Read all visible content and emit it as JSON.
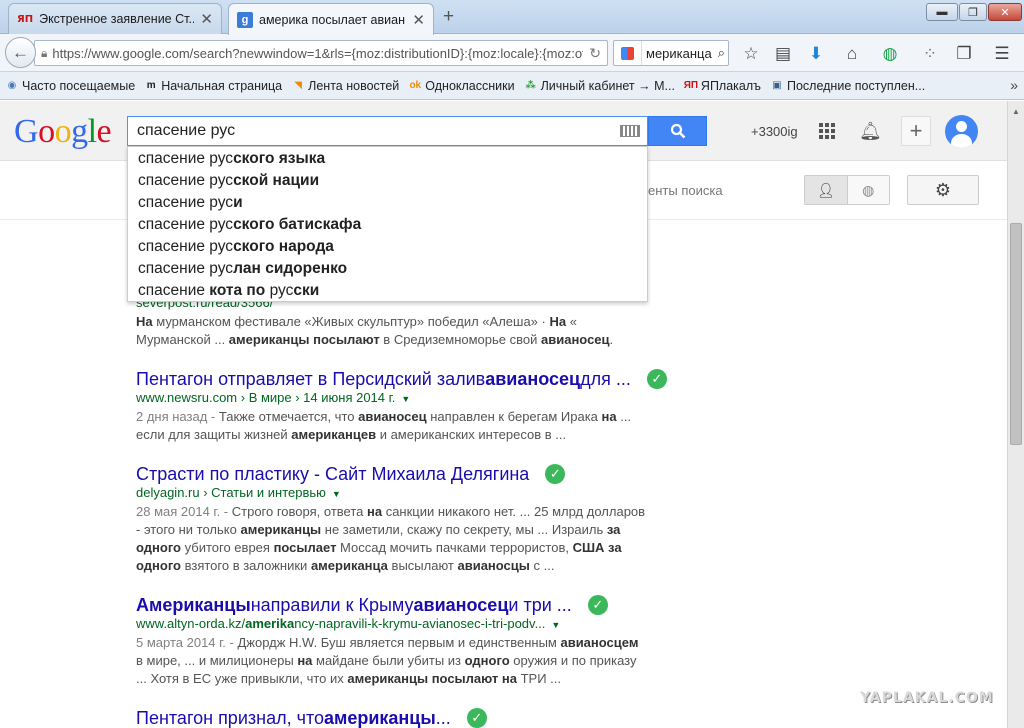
{
  "browser": {
    "tabs": [
      {
        "favicon": "ЯП",
        "title": "Экстренное заявление Ст...",
        "close": "✕"
      },
      {
        "favicon": "g",
        "title": "америка посылает авиан...",
        "close": "✕"
      }
    ],
    "new_tab": "+",
    "window_controls": {
      "minimize": "▬",
      "maximize": "❐",
      "close": "✕"
    },
    "url": "https://www.google.com/search?newwindow=1&rls={moz:distributionID}:{moz:locale}:{moz:offi",
    "search_value": "мериканца"
  },
  "bookmarks": [
    {
      "icon": "globe-icon",
      "glyph": "◉",
      "color": "#4a7ab5",
      "label": "Часто посещаемые"
    },
    {
      "icon": "m-logo-icon",
      "glyph": "m",
      "color": "#222222",
      "label": "Начальная страница"
    },
    {
      "icon": "rss-icon",
      "glyph": "◥",
      "color": "#f08a00",
      "label": "Лента новостей"
    },
    {
      "icon": "odnoklassniki-icon",
      "glyph": "ok",
      "color": "#f08a00",
      "label": "Одноклассники"
    },
    {
      "icon": "colored-dots-icon",
      "glyph": "⁂",
      "color": "#2e9d3a",
      "label": "Личный кабинет → М..."
    },
    {
      "icon": "yaplakal-icon",
      "glyph": "ЯП",
      "color": "#d01010",
      "label": "ЯПлакалъ"
    },
    {
      "icon": "page-icon",
      "glyph": "▣",
      "color": "#3a5f8a",
      "label": "Последние поступлен..."
    }
  ],
  "google": {
    "query": "спасение рус",
    "user_label": "+3300ig",
    "search_tools_fragment": "енты поиска",
    "suggestions": [
      [
        {
          "t": "спасение рус",
          "b": false
        },
        {
          "t": "ского языка",
          "b": true
        }
      ],
      [
        {
          "t": "спасение рус",
          "b": false
        },
        {
          "t": "ской нации",
          "b": true
        }
      ],
      [
        {
          "t": "спасение рус",
          "b": false
        },
        {
          "t": "и",
          "b": true
        }
      ],
      [
        {
          "t": "спасение рус",
          "b": false
        },
        {
          "t": "ского батискафа",
          "b": true
        }
      ],
      [
        {
          "t": "спасение рус",
          "b": false
        },
        {
          "t": "ского народа",
          "b": true
        }
      ],
      [
        {
          "t": "спасение рус",
          "b": false
        },
        {
          "t": "лан сидоренко",
          "b": true
        }
      ],
      [
        {
          "t": "спасение ",
          "b": false
        },
        {
          "t": "кота по ",
          "b": true
        },
        {
          "t": "рус",
          "b": false
        },
        {
          "t": "ски",
          "b": true
        }
      ]
    ],
    "results": [
      {
        "title": [],
        "url": "severpost.ru/read/3566/",
        "has_dropdown": false,
        "verified": false,
        "snippet": [
          [
            {
              "t": "На",
              "b": true
            },
            {
              "t": " мурманском фестивале «Живых скульптур» победил «Алеша» · ",
              "b": false
            },
            {
              "t": "На",
              "b": true
            },
            {
              "t": " «",
              "b": false
            }
          ],
          [
            {
              "t": "Мурманской ... ",
              "b": false
            },
            {
              "t": "американцы посылают",
              "b": true
            },
            {
              "t": " в Средиземноморье свой ",
              "b": false
            },
            {
              "t": "авианосец",
              "b": true
            },
            {
              "t": ".",
              "b": false
            }
          ]
        ]
      },
      {
        "title": [
          {
            "t": "Пентагон отправляет в Персидский залив ",
            "b": false
          },
          {
            "t": "авианосец",
            "b": true
          },
          {
            "t": " для ...",
            "b": false
          }
        ],
        "url": "www.newsru.com › В мире › 14 июня 2014 г.",
        "has_dropdown": true,
        "verified": true,
        "snippet": [
          [
            {
              "t": "2 дня назад - ",
              "d": true
            },
            {
              "t": "Также отмечается, что ",
              "b": false
            },
            {
              "t": "авианосец",
              "b": true
            },
            {
              "t": " направлен к берегам Ирака ",
              "b": false
            },
            {
              "t": "на",
              "b": true
            },
            {
              "t": " ...",
              "b": false
            }
          ],
          [
            {
              "t": "если для защиты жизней ",
              "b": false
            },
            {
              "t": "американцев",
              "b": true
            },
            {
              "t": " и американских интересов в ...",
              "b": false
            }
          ]
        ]
      },
      {
        "title": [
          {
            "t": "Страсти по пластику - Сайт Михаила Делягина",
            "b": false
          }
        ],
        "url": "delyagin.ru › Статьи и интервью",
        "has_dropdown": true,
        "verified": true,
        "snippet": [
          [
            {
              "t": "28 мая 2014 г. - ",
              "d": true
            },
            {
              "t": "Строго говоря, ответа ",
              "b": false
            },
            {
              "t": "на",
              "b": true
            },
            {
              "t": " санкции никакого нет. ... 25 млрд долларов",
              "b": false
            }
          ],
          [
            {
              "t": "- этого ни только ",
              "b": false
            },
            {
              "t": "американцы",
              "b": true
            },
            {
              "t": " не заметили, скажу по секрету, мы ... Израиль ",
              "b": false
            },
            {
              "t": "за",
              "b": true
            }
          ],
          [
            {
              "t": "одного",
              "b": true
            },
            {
              "t": " убитого еврея ",
              "b": false
            },
            {
              "t": "посылает",
              "b": true
            },
            {
              "t": " Моссад мочить пачками террористов, ",
              "b": false
            },
            {
              "t": "США за",
              "b": true
            }
          ],
          [
            {
              "t": "одного",
              "b": true
            },
            {
              "t": " взятого в заложники ",
              "b": false
            },
            {
              "t": "американца",
              "b": true
            },
            {
              "t": " высылают ",
              "b": false
            },
            {
              "t": "авианосцы",
              "b": true
            },
            {
              "t": " с ...",
              "b": false
            }
          ]
        ]
      },
      {
        "title": [
          {
            "t": "Американцы",
            "b": true
          },
          {
            "t": " направили к Крыму ",
            "b": false
          },
          {
            "t": "авианосец",
            "b": true
          },
          {
            "t": " и три ...",
            "b": false
          }
        ],
        "url_parts": [
          {
            "t": "www.altyn-orda.kz/",
            "b": false
          },
          {
            "t": "amerika",
            "b": true
          },
          {
            "t": "ncy-napravili-k-krymu-avianosec-i-tri-podv...",
            "b": false
          }
        ],
        "url": "",
        "has_dropdown": true,
        "verified": true,
        "snippet": [
          [
            {
              "t": "5 марта 2014 г. - ",
              "d": true
            },
            {
              "t": "Джордж H.W. Буш является первым и единственным ",
              "b": false
            },
            {
              "t": "авианосцем",
              "b": true
            }
          ],
          [
            {
              "t": "в мире, ... и милиционеры ",
              "b": false
            },
            {
              "t": "на",
              "b": true
            },
            {
              "t": " майдане были убиты из ",
              "b": false
            },
            {
              "t": "одного",
              "b": true
            },
            {
              "t": " оружия и по приказу",
              "b": false
            }
          ],
          [
            {
              "t": "... Хотя в ЕС уже привыкли, что их ",
              "b": false
            },
            {
              "t": "американцы посылают на",
              "b": true
            },
            {
              "t": " ТРИ ...",
              "b": false
            }
          ]
        ]
      },
      {
        "title": [
          {
            "t": "Пентагон признал, что ",
            "b": false
          },
          {
            "t": "американцы",
            "b": true
          },
          {
            "t": " ...",
            "b": false
          }
        ],
        "url": "",
        "has_dropdown": false,
        "verified": true,
        "snippet": []
      }
    ]
  },
  "watermark": "YAPLAKAL.COM"
}
